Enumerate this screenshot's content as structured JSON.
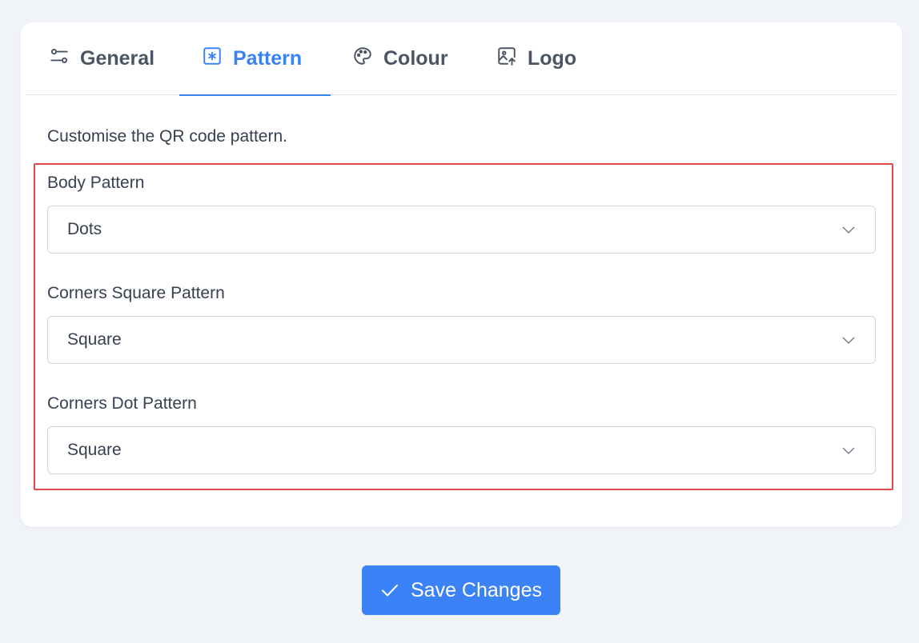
{
  "tabs": [
    {
      "label": "General",
      "icon": "sliders-icon",
      "active": false
    },
    {
      "label": "Pattern",
      "icon": "asterisk-square-icon",
      "active": true
    },
    {
      "label": "Colour",
      "icon": "palette-icon",
      "active": false
    },
    {
      "label": "Logo",
      "icon": "image-upload-icon",
      "active": false
    }
  ],
  "intro": "Customise the QR code pattern.",
  "fields": {
    "body_pattern": {
      "label": "Body Pattern",
      "value": "Dots"
    },
    "corners_square": {
      "label": "Corners Square Pattern",
      "value": "Square"
    },
    "corners_dot": {
      "label": "Corners Dot Pattern",
      "value": "Square"
    }
  },
  "save_label": "Save Changes",
  "colors": {
    "accent": "#3b82f6",
    "highlight": "#e54848",
    "background": "#f0f3f8"
  }
}
